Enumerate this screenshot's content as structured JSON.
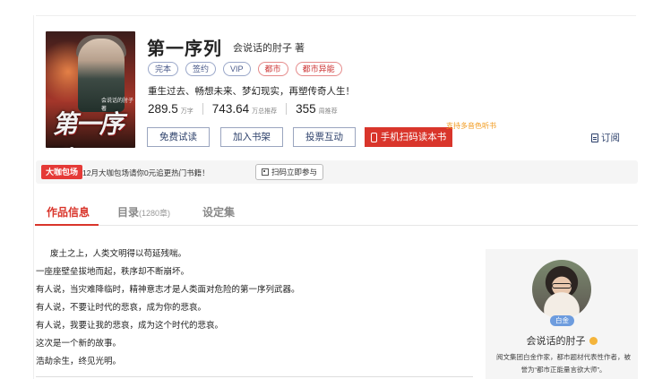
{
  "book": {
    "title": "第一序列",
    "author_line": "会说话的肘子  著",
    "cover_title": "第一序列",
    "cover_subtitle": "会说话的肘子 著",
    "tags": [
      {
        "label": "完本",
        "style": "blue"
      },
      {
        "label": "签约",
        "style": "blue"
      },
      {
        "label": "VIP",
        "style": "blue"
      },
      {
        "label": "都市",
        "style": "red"
      },
      {
        "label": "都市异能",
        "style": "red"
      }
    ],
    "intro": "重生过去、畅想未来、梦幻现实，再塑传奇人生！",
    "stats": [
      {
        "value": "289.5",
        "unit": "万字"
      },
      {
        "value": "743.64",
        "unit": "万总推荐"
      },
      {
        "value": "355",
        "unit": "周推荐"
      }
    ]
  },
  "actions": {
    "try_read": "免费试读",
    "add_shelf": "加入书架",
    "vote": "投票互动",
    "scan_read": "手机扫码读本书",
    "voice_hint": "支持多音色听书",
    "subscribe": "订阅"
  },
  "promo": {
    "badge": "大咖包场",
    "text": "12月大咖包场请你0元追更热门书籍！",
    "button": "扫码立即参与"
  },
  "tabs": [
    {
      "label": "作品信息",
      "count": ""
    },
    {
      "label": "目录",
      "count": "(1280章)"
    },
    {
      "label": "设定集",
      "count": ""
    }
  ],
  "description": [
    "废土之上，人类文明得以苟延残喘。",
    "一座座壁垒拔地而起，秩序却不断崩坏。",
    "有人说，当灾难降临时，精神意志才是人类面对危险的第一序列武器。",
    "有人说，不要让时代的悲哀，成为你的悲哀。",
    "有人说，我要让我的悲哀，成为这个时代的悲哀。",
    "这次是一个新的故事。",
    "浩劫余生，终见光明。"
  ],
  "author_card": {
    "badge": "白金",
    "name": "会说话的肘子",
    "bio": "阅文集团白金作家，都市题材代表性作者，被誉为“都市正能量言欲大师”。"
  },
  "colors": {
    "accent_red": "#d9352b",
    "tag_blue": "#4a5a8a",
    "voice_orange": "#f29a1d"
  }
}
